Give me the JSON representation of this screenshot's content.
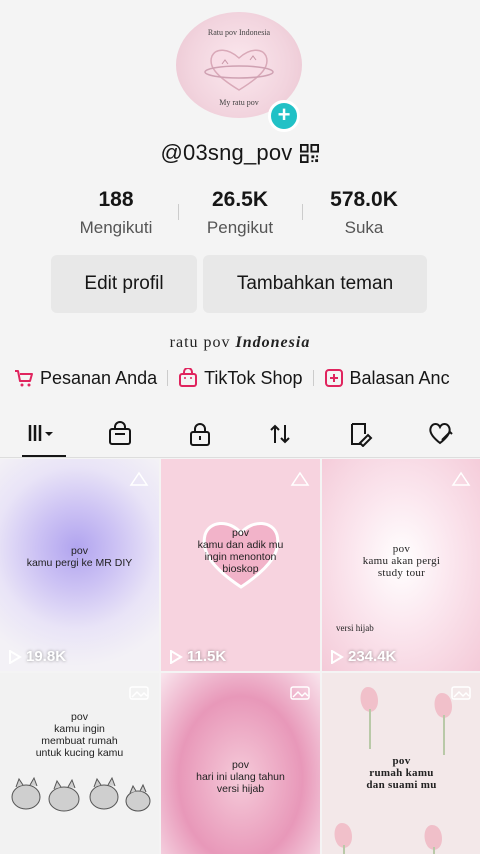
{
  "profile": {
    "avatar_top_text": "Ratu pov Indonesia",
    "avatar_bottom_text": "My ratu pov",
    "username": "@03sng_pov",
    "bio_plain": "ratu pov",
    "bio_italic": "Indonesia"
  },
  "stats": [
    {
      "value": "188",
      "label": "Mengikuti"
    },
    {
      "value": "26.5K",
      "label": "Pengikut"
    },
    {
      "value": "578.0K",
      "label": "Suka"
    }
  ],
  "buttons": {
    "edit_profile": "Edit profil",
    "add_friends": "Tambahkan teman"
  },
  "links": [
    {
      "label": "Pesanan Anda",
      "icon": "cart-icon"
    },
    {
      "label": "TikTok Shop",
      "icon": "shop-bag-icon"
    },
    {
      "label": "Balasan Anc",
      "icon": "plus-square-icon"
    }
  ],
  "tabs": [
    "videos-grid-icon",
    "shop-bag-icon",
    "lock-icon",
    "repost-icon",
    "favorites-icon",
    "liked-icon"
  ],
  "videos": [
    {
      "title_lines": [
        "pov",
        "kamu pergi ke MR DIY"
      ],
      "views": "19.8K"
    },
    {
      "title_lines": [
        "pov",
        "kamu dan adik mu",
        "ingin menonton",
        "bioskop"
      ],
      "views": "11.5K"
    },
    {
      "title_lines": [
        "pov",
        "kamu akan pergi",
        "study tour"
      ],
      "extra": "versi hijab",
      "views": "234.4K"
    },
    {
      "title_lines": [
        "pov",
        "kamu ingin",
        "membuat rumah",
        "untuk kucing kamu"
      ],
      "views": ""
    },
    {
      "title_lines": [
        "pov",
        "hari ini ulang tahun",
        "versi hijab"
      ],
      "views": ""
    },
    {
      "title_lines": [
        "pov",
        "rumah kamu",
        "dan suami mu"
      ],
      "views": ""
    }
  ],
  "colors": {
    "accent": "#21c1c6",
    "shop": "#e0245e"
  }
}
